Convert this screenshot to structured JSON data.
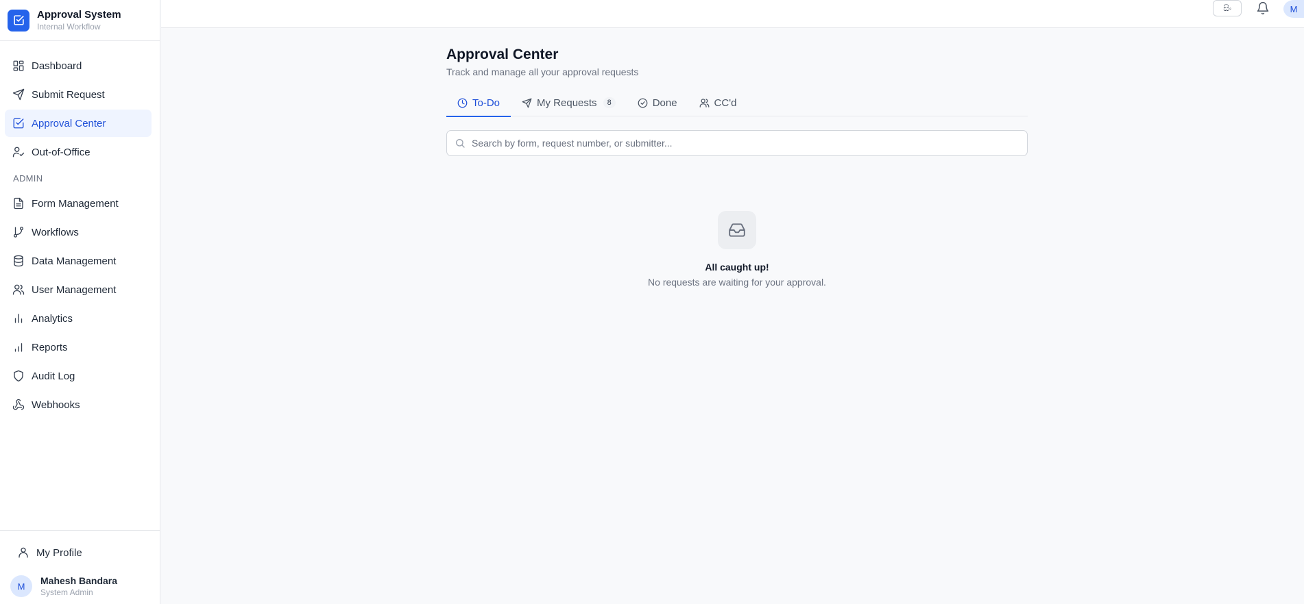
{
  "brand": {
    "title": "Approval System",
    "subtitle": "Internal Workflow"
  },
  "sidebar": {
    "items": [
      {
        "label": "Dashboard",
        "icon": "dashboard-grid-icon"
      },
      {
        "label": "Submit Request",
        "icon": "send-icon"
      },
      {
        "label": "Approval Center",
        "icon": "check-square-icon",
        "active": true
      },
      {
        "label": "Out-of-Office",
        "icon": "user-check-icon"
      }
    ],
    "admin_section_label": "ADMIN",
    "admin_items": [
      {
        "label": "Form Management",
        "icon": "file-text-icon"
      },
      {
        "label": "Workflows",
        "icon": "git-branch-icon"
      },
      {
        "label": "Data Management",
        "icon": "database-icon"
      },
      {
        "label": "User Management",
        "icon": "users-icon"
      },
      {
        "label": "Analytics",
        "icon": "bar-chart-icon"
      },
      {
        "label": "Reports",
        "icon": "bar-chart-icon"
      },
      {
        "label": "Audit Log",
        "icon": "shield-icon"
      },
      {
        "label": "Webhooks",
        "icon": "webhook-icon"
      }
    ],
    "profile_label": "My Profile",
    "user": {
      "initial": "M",
      "name": "Mahesh Bandara",
      "role": "System Admin"
    }
  },
  "topbar": {
    "language_label": "සිං",
    "avatar_initial": "M"
  },
  "main": {
    "title": "Approval Center",
    "subtitle": "Track and manage all your approval requests",
    "tabs": [
      {
        "label": "To-Do",
        "icon": "clock-icon",
        "active": true
      },
      {
        "label": "My Requests",
        "icon": "send-icon",
        "badge": "8"
      },
      {
        "label": "Done",
        "icon": "check-circle-icon"
      },
      {
        "label": "CC'd",
        "icon": "users-icon"
      }
    ],
    "search_placeholder": "Search by form, request number, or submitter...",
    "empty_state": {
      "title": "All caught up!",
      "message": "No requests are waiting for your approval."
    }
  },
  "colors": {
    "accent": "#2563eb",
    "active_bg": "#eff4ff",
    "page_bg": "#f8f9fb"
  }
}
